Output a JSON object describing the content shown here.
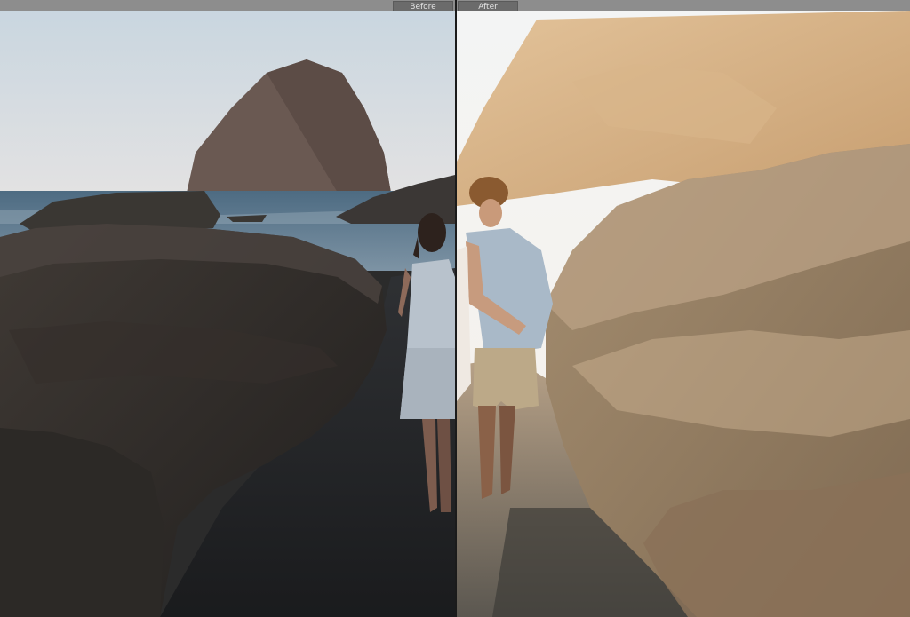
{
  "view": {
    "before_label": "Before",
    "after_label": "After"
  },
  "colors": {
    "toolbar": "#8d8d8d",
    "label_bg": "#6b6b6b",
    "divider": "#1b1b1b"
  }
}
